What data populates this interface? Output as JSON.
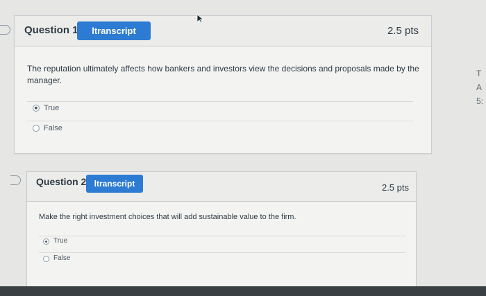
{
  "questions": [
    {
      "title": "Question 1",
      "transcript_label": "ltranscript",
      "points": "2.5 pts",
      "text": "The reputation ultimately affects how bankers and investors view the decisions and proposals made by the manager.",
      "options": [
        {
          "label": "True",
          "selected": true
        },
        {
          "label": "False",
          "selected": false
        }
      ]
    },
    {
      "title": "Question 2",
      "transcript_label": "ltranscript",
      "points": "2.5 pts",
      "text": "Make the right investment choices that will add sustainable value to the firm.",
      "options": [
        {
          "label": "True",
          "selected": true
        },
        {
          "label": "False",
          "selected": false
        }
      ]
    }
  ],
  "side_panel": {
    "letters": [
      "T",
      "A",
      "5:"
    ]
  },
  "colors": {
    "accent": "#2d7bd3",
    "background": "#e6e6e4",
    "card": "#f3f3f1"
  }
}
